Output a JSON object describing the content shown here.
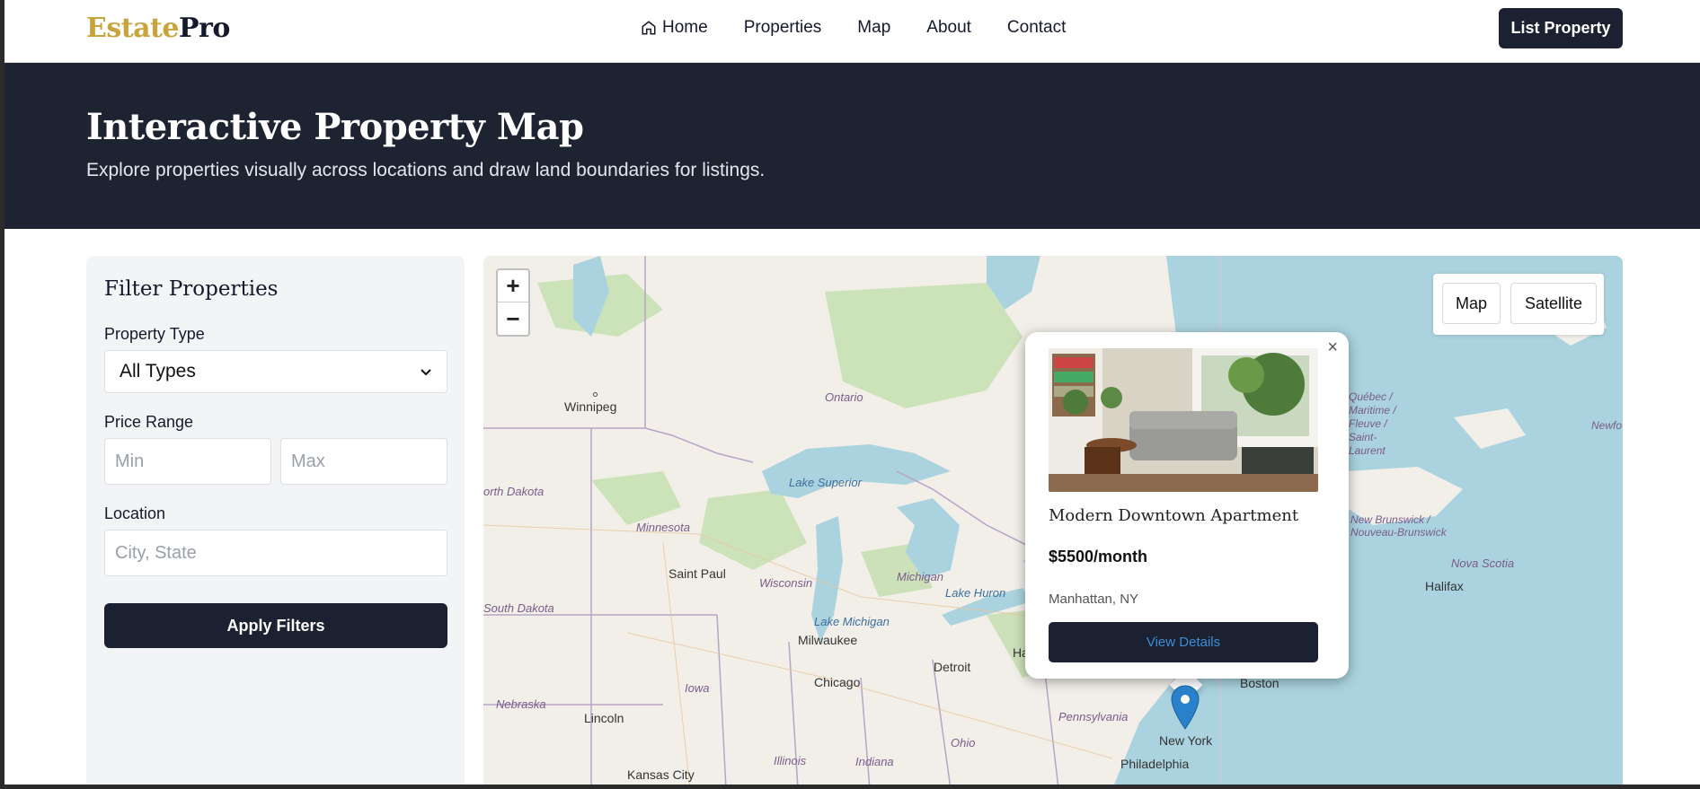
{
  "header": {
    "logo_part1": "Estate",
    "logo_part2": "Pro",
    "nav": [
      "Home",
      "Properties",
      "Map",
      "About",
      "Contact"
    ],
    "cta_label": "List Property"
  },
  "hero": {
    "title": "Interactive Property Map",
    "subtitle": "Explore properties visually across locations and draw land boundaries for listings."
  },
  "filters": {
    "title": "Filter Properties",
    "type_label": "Property Type",
    "type_value": "All Types",
    "price_label": "Price Range",
    "min_placeholder": "Min",
    "max_placeholder": "Max",
    "location_label": "Location",
    "location_placeholder": "City, State",
    "apply_label": "Apply Filters"
  },
  "map": {
    "zoom_in": "+",
    "zoom_out": "−",
    "layers": [
      "Map",
      "Satellite"
    ],
    "labels": {
      "winnipeg": "Winnipeg",
      "ontario": "Ontario",
      "lake_superior": "Lake Superior",
      "north_dakota": "orth Dakota",
      "minnesota": "Minnesota",
      "saint_paul": "Saint Paul",
      "wisconsin": "Wisconsin",
      "michigan": "Michigan",
      "lake_huron": "Lake Huron",
      "south_dakota": "South Dakota",
      "lake_michigan": "Lake Michigan",
      "milwaukee": "Milwaukee",
      "detroit": "Detroit",
      "chicago": "Chicago",
      "iowa": "Iowa",
      "nebraska": "Nebraska",
      "lincoln": "Lincoln",
      "illinois": "Illinois",
      "indiana": "Indiana",
      "ohio": "Ohio",
      "pennsylvania": "Pennsylvania",
      "kansas_city": "Kansas City",
      "philadelphia": "Philadelphia",
      "new_york": "New York",
      "boston": "Boston",
      "halifax": "Halifax",
      "nova_scotia": "Nova Scotia",
      "new_brunswick": "New Brunswick / Nouveau-Brunswick",
      "newfo": "Newfo",
      "ha": "Ha",
      "quebec_frag": "Québec / Maritime / Fleuve / Saint-Laurent"
    },
    "popup": {
      "close": "×",
      "title": "Modern Downtown Apartment",
      "price": "$5500/month",
      "location": "Manhattan, NY",
      "button": "View Details"
    },
    "colors": {
      "water": "#aad3df",
      "land": "#f2efe9",
      "forest": "#c8e0b4",
      "marker": "#2a81cb"
    }
  }
}
